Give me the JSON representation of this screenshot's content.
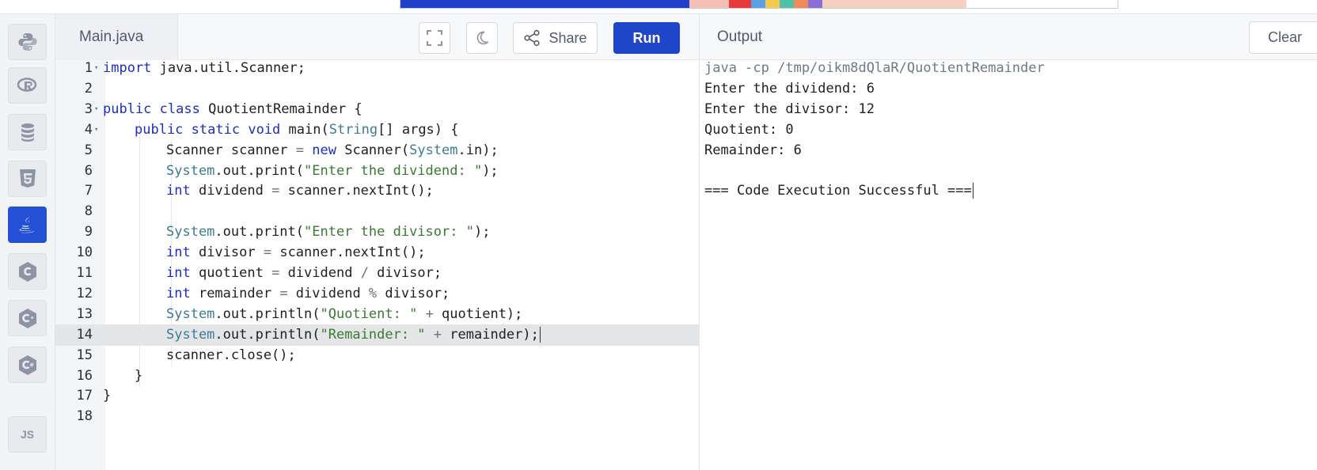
{
  "editor": {
    "filename": "Main.java",
    "share_label": "Share",
    "run_label": "Run",
    "lines": [
      {
        "n": "1",
        "fold": true
      },
      {
        "n": "2"
      },
      {
        "n": "3",
        "fold": true
      },
      {
        "n": "4",
        "fold": true
      },
      {
        "n": "5"
      },
      {
        "n": "6"
      },
      {
        "n": "7"
      },
      {
        "n": "8"
      },
      {
        "n": "9"
      },
      {
        "n": "10"
      },
      {
        "n": "11"
      },
      {
        "n": "12"
      },
      {
        "n": "13"
      },
      {
        "n": "14",
        "active": true
      },
      {
        "n": "15"
      },
      {
        "n": "16"
      },
      {
        "n": "17"
      },
      {
        "n": "18"
      }
    ],
    "code": [
      [
        [
          "kw",
          "import"
        ],
        [
          "",
          "java.util.Scanner;"
        ]
      ],
      [],
      [
        [
          "kw",
          "public"
        ],
        [
          "",
          " "
        ],
        [
          "kw",
          "class"
        ],
        [
          "",
          " QuotientRemainder {"
        ]
      ],
      [
        [
          "",
          " "
        ],
        [
          "kw",
          "public"
        ],
        [
          "",
          " "
        ],
        [
          "kw",
          "static"
        ],
        [
          "",
          " "
        ],
        [
          "kw",
          "void"
        ],
        [
          "",
          " main("
        ],
        [
          "ty",
          "String"
        ],
        [
          "",
          "[] args) {"
        ]
      ],
      [
        [
          "",
          "Scanner scanner "
        ],
        [
          "op",
          "="
        ],
        [
          "",
          " "
        ],
        [
          "kw",
          "new"
        ],
        [
          "",
          " Scanner("
        ],
        [
          "ty",
          "System"
        ],
        [
          "",
          ".in);"
        ]
      ],
      [
        [
          "ty",
          "System"
        ],
        [
          "",
          ".out.print("
        ],
        [
          "st",
          "\"Enter the dividend: \""
        ],
        [
          "",
          ");"
        ]
      ],
      [
        [
          "kw",
          "int"
        ],
        [
          "",
          " dividend "
        ],
        [
          "op",
          "="
        ],
        [
          "",
          " scanner.nextInt();"
        ]
      ],
      [],
      [
        [
          "ty",
          "System"
        ],
        [
          "",
          ".out.print("
        ],
        [
          "st",
          "\"Enter the divisor: \""
        ],
        [
          "",
          ");"
        ]
      ],
      [
        [
          "kw",
          "int"
        ],
        [
          "",
          " divisor "
        ],
        [
          "op",
          "="
        ],
        [
          "",
          " scanner.nextInt();"
        ]
      ],
      [
        [
          "kw",
          "int"
        ],
        [
          "",
          " quotient "
        ],
        [
          "op",
          "="
        ],
        [
          "",
          " dividend "
        ],
        [
          "op",
          "/"
        ],
        [
          "",
          " divisor;"
        ]
      ],
      [
        [
          "kw",
          "int"
        ],
        [
          "",
          " remainder "
        ],
        [
          "op",
          "="
        ],
        [
          "",
          " dividend "
        ],
        [
          "op",
          "%"
        ],
        [
          "",
          " divisor;"
        ]
      ],
      [
        [
          "ty",
          "System"
        ],
        [
          "",
          ".out.println("
        ],
        [
          "st",
          "\"Quotient: \""
        ],
        [
          "",
          " "
        ],
        [
          "op",
          "+"
        ],
        [
          "",
          " quotient);"
        ]
      ],
      [
        [
          "ty",
          "System"
        ],
        [
          "",
          ".out.println("
        ],
        [
          "st",
          "\"Remainder: \""
        ],
        [
          "",
          " "
        ],
        [
          "op",
          "+"
        ],
        [
          "",
          " remainder);"
        ]
      ],
      [
        [
          "",
          "scanner.close();"
        ]
      ],
      [
        [
          "",
          "}"
        ]
      ],
      [
        [
          "",
          "}"
        ]
      ],
      []
    ],
    "indents": [
      0,
      0,
      0,
      1,
      2,
      2,
      2,
      2,
      2,
      2,
      2,
      2,
      2,
      2,
      2,
      1,
      0,
      0
    ]
  },
  "output": {
    "title": "Output",
    "clear_label": "Clear",
    "lines": [
      "java -cp /tmp/oikm8dQlaR/QuotientRemainder",
      "Enter the dividend: 6",
      "Enter the divisor: 12",
      "Quotient: 0",
      "Remainder: 6",
      "",
      "=== Code Execution Successful ==="
    ]
  },
  "rail": {
    "items": [
      {
        "name": "python-icon"
      },
      {
        "name": "r-icon"
      },
      {
        "name": "database-icon"
      },
      {
        "name": "html5-icon"
      },
      {
        "name": "java-icon",
        "active": true
      },
      {
        "name": "c-icon"
      },
      {
        "name": "cpp-icon"
      },
      {
        "name": "csharp-icon"
      },
      {
        "name": "js-icon",
        "text": "JS"
      }
    ]
  },
  "colors": {
    "accent": "#1f45c9",
    "keyword": "#1c2fbf",
    "string": "#3a7a32",
    "type": "#3b7c92"
  }
}
